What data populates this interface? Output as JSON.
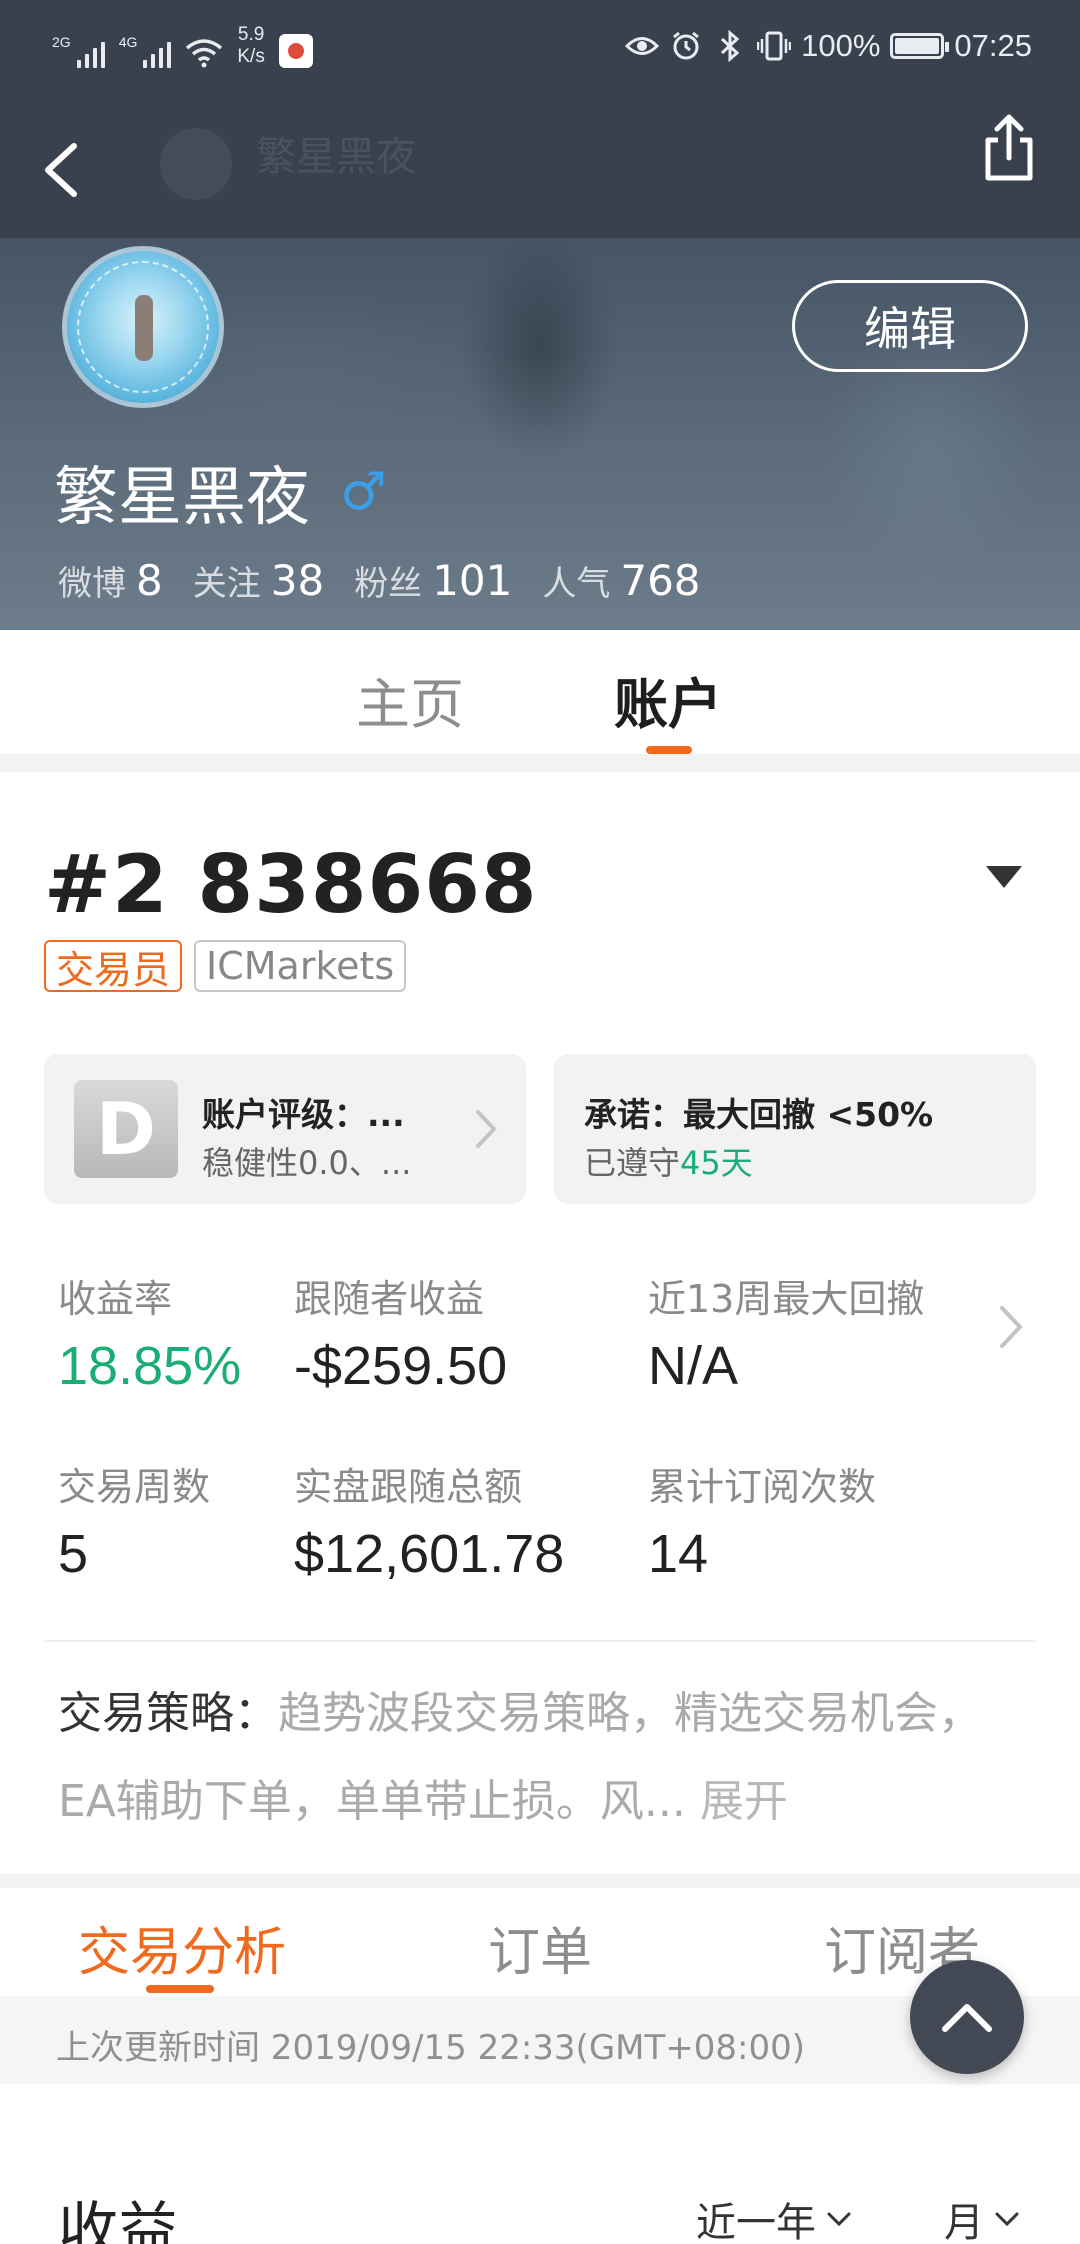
{
  "status_bar": {
    "signal1_label": "2G",
    "signal2_label": "4G",
    "net_speed_value": "5.9",
    "net_speed_unit": "K/s",
    "battery_percent": "100%",
    "time": "07:25",
    "icons": [
      "eye-icon",
      "alarm-icon",
      "bluetooth-icon",
      "vibrate-icon",
      "battery-icon"
    ]
  },
  "nav": {
    "back_icon": "chevron-left-icon",
    "faded_title": "繁星黑夜",
    "share_icon": "share-icon"
  },
  "profile": {
    "edit_label": "编辑",
    "nickname": "繁星黑夜",
    "gender_symbol": "♂",
    "stats": [
      {
        "label": "微博",
        "value": "8"
      },
      {
        "label": "关注",
        "value": "38"
      },
      {
        "label": "粉丝",
        "value": "101"
      },
      {
        "label": "人气",
        "value": "768"
      }
    ]
  },
  "top_tabs": [
    {
      "label": "主页",
      "active": false
    },
    {
      "label": "账户",
      "active": true
    }
  ],
  "account": {
    "number": "#2 838668",
    "tags": [
      "交易员",
      "ICMarkets"
    ],
    "rating_card": {
      "grade": "D",
      "title": "账户评级：...",
      "subtitle": "稳健性0.0、..."
    },
    "promise_card": {
      "title": "承诺：最大回撤 <50%",
      "kept_prefix": "已遵守",
      "kept_days": "45天"
    }
  },
  "metrics": [
    {
      "label": "收益率",
      "value": "18.85%",
      "highlight": true
    },
    {
      "label": "跟随者收益",
      "value": "-$259.50",
      "highlight": false
    },
    {
      "label": "近13周最大回撤",
      "value": "N/A",
      "highlight": false
    },
    {
      "label": "交易周数",
      "value": "5",
      "highlight": false
    },
    {
      "label": "实盘跟随总额",
      "value": "$12,601.78",
      "highlight": false
    },
    {
      "label": "累计订阅次数",
      "value": "14",
      "highlight": false
    }
  ],
  "strategy": {
    "label": "交易策略：",
    "text": "趋势波段交易策略，精选交易机会，EA辅助下单，单单带止损。风...",
    "expand_label": "展开"
  },
  "bottom_tabs": [
    {
      "label": "交易分析",
      "active": true
    },
    {
      "label": "订单",
      "active": false
    },
    {
      "label": "订阅者",
      "active": false
    }
  ],
  "update_info": "上次更新时间 2019/09/15 22:33(GMT+08:00)",
  "income": {
    "title": "收益",
    "period_filter": "近一年",
    "unit_filter": "月"
  },
  "colors": {
    "accent_orange": "#f06a1e",
    "positive_green": "#1aae76",
    "header_dark": "#38414d",
    "fab_bg": "#424854",
    "gender_blue": "#3a9fe8"
  }
}
